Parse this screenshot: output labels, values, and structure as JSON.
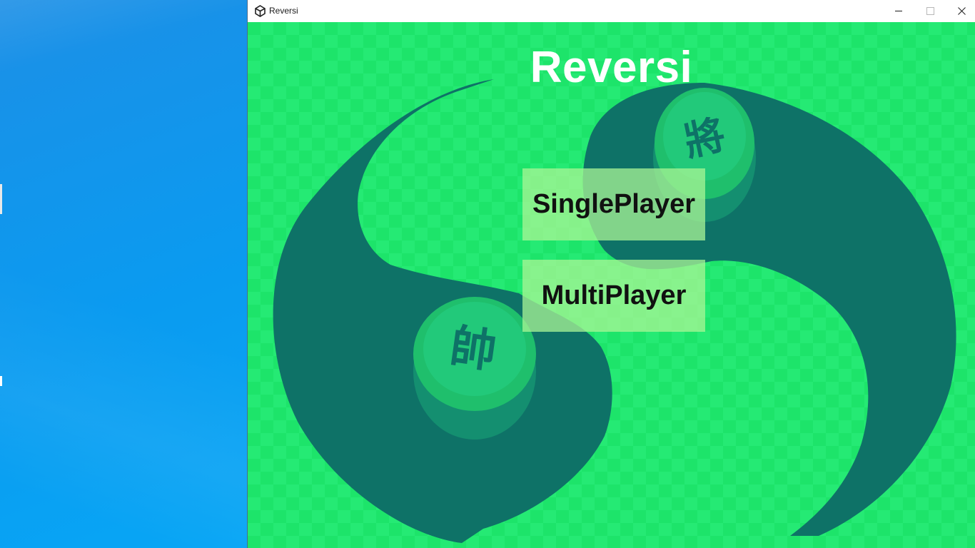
{
  "window": {
    "title": "Reversi",
    "app_icon": "unity-icon",
    "controls": [
      "minimize-icon",
      "maximize-icon",
      "close-icon"
    ]
  },
  "game": {
    "title": "Reversi",
    "single_player_label": "SinglePlayer",
    "multi_player_label": "MultiPlayer",
    "piece_top_char": "將",
    "piece_bottom_char": "帥"
  },
  "colors": {
    "background_green": "#1de46a",
    "ink": "#0e7267",
    "button_fill": "#a8f29a",
    "desktop_blue": "#0a9bf0"
  }
}
